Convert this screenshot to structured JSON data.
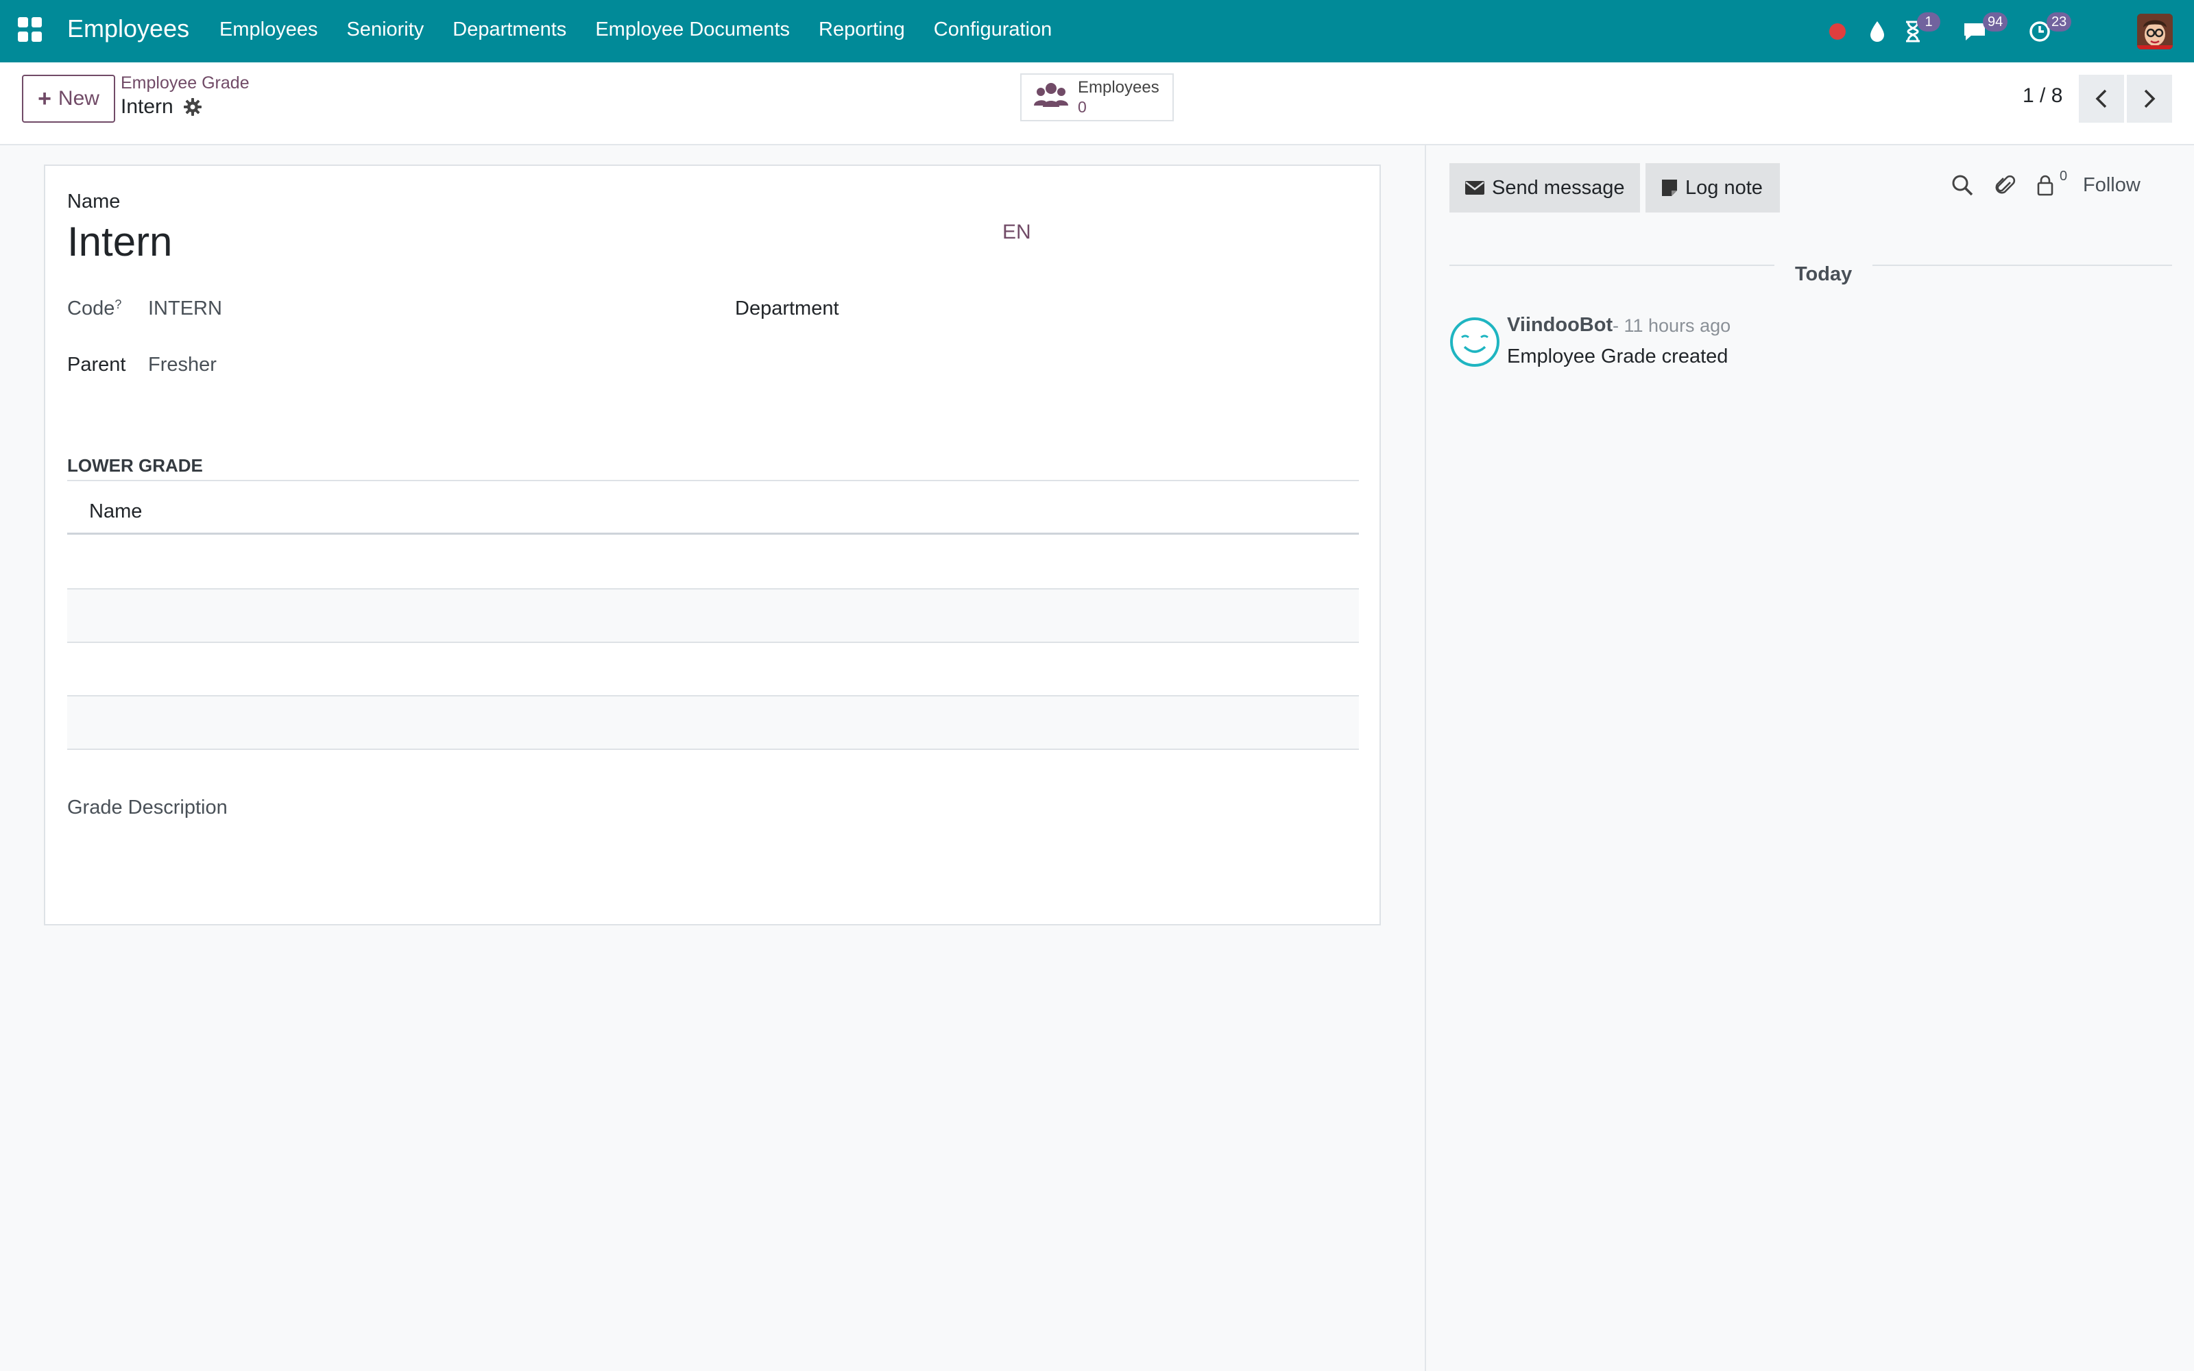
{
  "navbar": {
    "app_title": "Employees",
    "menu": [
      "Employees",
      "Seniority",
      "Departments",
      "Employee Documents",
      "Reporting",
      "Configuration"
    ],
    "systray": {
      "activity_badge": "1",
      "messages_badge": "94",
      "clock_badge": "23"
    },
    "colors": {
      "navbar_bg": "#018a98",
      "accent": "#714b67",
      "badge": "#71639e",
      "recording_dot": "#e03e3e"
    }
  },
  "control_panel": {
    "new_label": "New",
    "breadcrumb": "Employee Grade",
    "record_title": "Intern",
    "stat_button": {
      "label": "Employees",
      "value": "0"
    },
    "pager": "1 / 8"
  },
  "form": {
    "name_label": "Name",
    "name_value": "Intern",
    "lang_button": "EN",
    "code_label": "Code",
    "code_help": "?",
    "code_value": "INTERN",
    "department_label": "Department",
    "parent_label": "Parent",
    "parent_value": "Fresher",
    "lower_grade_title": "LOWER GRADE",
    "lower_grade_columns": [
      "Name"
    ],
    "description_label": "Grade Description"
  },
  "chatter": {
    "send_message_label": "Send message",
    "log_note_label": "Log note",
    "follower_count": "0",
    "follow_label": "Follow",
    "day_separator": "Today",
    "messages": [
      {
        "author": "ViindooBot",
        "time": "- 11 hours ago",
        "body": "Employee Grade created"
      }
    ]
  }
}
